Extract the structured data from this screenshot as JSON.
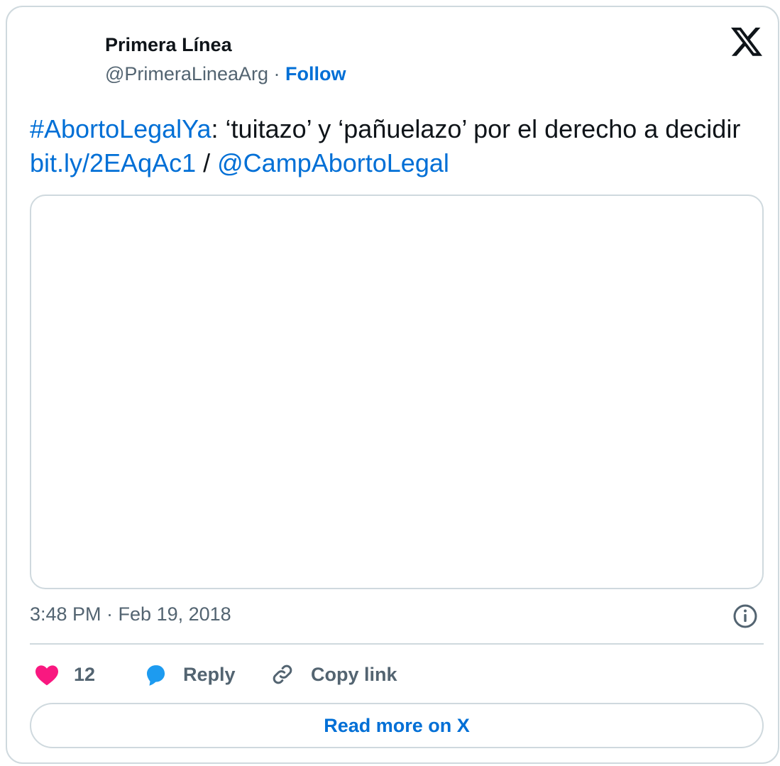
{
  "author": {
    "name": "Primera Línea",
    "handle": "@PrimeraLineaArg",
    "separator": "·",
    "follow_label": "Follow"
  },
  "tweet": {
    "hashtag": "#AbortoLegalYa",
    "text_part1": ": ‘tuitazo’ y ‘pañuelazo’ por el derecho a decidir ",
    "link": "bit.ly/2EAqAc1",
    "text_part2": " / ",
    "mention": "@CampAbortoLegal"
  },
  "timestamp": "3:48 PM · Feb 19, 2018",
  "actions": {
    "like_count": "12",
    "reply_label": "Reply",
    "copy_link_label": "Copy link"
  },
  "read_more_label": "Read more on X",
  "colors": {
    "link": "#006fd6",
    "heart": "#f91880",
    "reply_bubble": "#1d9bf0",
    "border": "#cfd9de",
    "muted_text": "#536471"
  },
  "icons": [
    "x-logo-icon",
    "info-icon",
    "heart-icon",
    "reply-bubble-icon",
    "link-icon"
  ]
}
